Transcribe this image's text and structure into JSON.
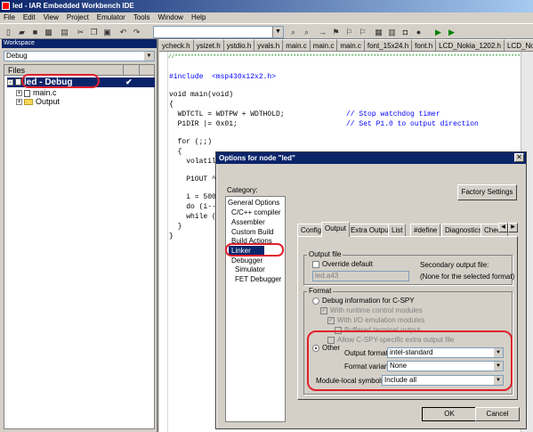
{
  "window": {
    "title": "led - IAR Embedded Workbench IDE"
  },
  "menu": [
    "File",
    "Edit",
    "View",
    "Project",
    "Emulator",
    "Tools",
    "Window",
    "Help"
  ],
  "workspace": {
    "title": "Workspace",
    "config": "Debug",
    "files_header": "Files",
    "tree": [
      {
        "label": "led - Debug",
        "check": "✔"
      },
      {
        "label": "main.c"
      },
      {
        "label": "Output"
      }
    ]
  },
  "editor": {
    "tabs": [
      "ycheck.h",
      "ysizet.h",
      "ystdio.h",
      "yvals.h",
      "main.c",
      "main.c",
      "main.c",
      "font_15x24.h",
      "font.h",
      "LCD_Nokia_1202.h",
      "LCD_Nokia_1202.h"
    ],
    "code": [
      {
        "text": "#include  <msp430x12x2.h>",
        "comment": ""
      },
      {
        "text": "void main(void)",
        "comment": ""
      },
      {
        "text": "{",
        "comment": ""
      },
      {
        "text": "  WDTCTL = WDTPW + WDTHOLD;",
        "comment": "// Stop watchdog timer"
      },
      {
        "text": "  P1DIR |= 0x01;",
        "comment": "// Set P1.0 to output direction"
      },
      {
        "text": "  for (;;)",
        "comment": ""
      },
      {
        "text": "  {",
        "comment": ""
      },
      {
        "text": "    volatil",
        "comment": ""
      },
      {
        "text": "    P1OUT ^=",
        "comment": ""
      },
      {
        "text": "    i = 5000",
        "comment": ""
      },
      {
        "text": "    do (i--)",
        "comment": ""
      },
      {
        "text": "    while (i",
        "comment": ""
      },
      {
        "text": "  }",
        "comment": ""
      },
      {
        "text": "}",
        "comment": ""
      }
    ]
  },
  "dialog": {
    "title": "Options for node \"led\"",
    "close": "✕",
    "category_label": "Category:",
    "categories": [
      "General Options",
      "C/C++ compiler",
      "Assembler",
      "Custom Build",
      "Build Actions",
      "Linker",
      "Debugger",
      "Simulator",
      "FET Debugger"
    ],
    "factory_settings": "Factory Settings",
    "tabs": [
      "Config",
      "Output",
      "Extra Output",
      "List",
      "#define",
      "Diagnostics",
      "Check"
    ],
    "output_file": {
      "group": "Output file",
      "override": "Override default",
      "filename": "led.a43",
      "secondary_label": "Secondary output file:",
      "secondary_value": "(None for the selected format)"
    },
    "format": {
      "group": "Format",
      "debug_info": "Debug information for C-SPY",
      "runtime_control": "With runtime control modules",
      "io_emulation": "With I/O emulation modules",
      "buffered": "Buffered terminal output",
      "allow_cspy": "Allow C-SPY-specific extra output file",
      "other": "Other",
      "output_format_label": "Output format:",
      "output_format": "intel-standard",
      "format_variant_label": "Format variant:",
      "format_variant": "None",
      "module_local_label": "Module-local symbols:",
      "module_local": "Include all"
    },
    "ok": "OK",
    "cancel": "Cancel"
  }
}
